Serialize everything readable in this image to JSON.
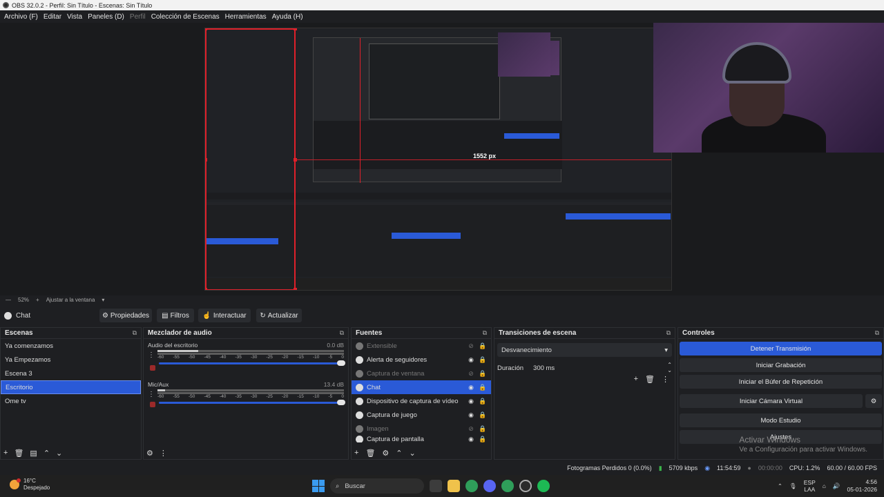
{
  "window": {
    "title": "OBS 32.0.2 - Perfil: Sin Título - Escenas: Sin Título"
  },
  "menu": [
    {
      "label": "Archivo (F)",
      "enabled": true
    },
    {
      "label": "Editar",
      "enabled": true
    },
    {
      "label": "Vista",
      "enabled": true
    },
    {
      "label": "Paneles (D)",
      "enabled": true
    },
    {
      "label": "Perfil",
      "enabled": false
    },
    {
      "label": "Colección de Escenas",
      "enabled": true
    },
    {
      "label": "Herramientas",
      "enabled": true
    },
    {
      "label": "Ayuda (H)",
      "enabled": true
    }
  ],
  "preview": {
    "measure_label": "1552 px"
  },
  "zoom": {
    "level": "52%",
    "fit_label": "Ajustar a la ventana"
  },
  "source_toolbar": {
    "current_source": "Chat",
    "properties_label": "Propiedades",
    "filters_label": "Filtros",
    "interact_label": "Interactuar",
    "refresh_label": "Actualizar"
  },
  "scenes": {
    "title": "Escenas",
    "items": [
      "Ya comenzamos",
      "Ya Empezamos",
      "Escena 3",
      "Escritorio",
      "Ome tv"
    ],
    "selected_index": 3
  },
  "mixer": {
    "title": "Mezclador de audio",
    "channels": [
      {
        "name": "Audio del escritorio",
        "db": "0.0 dB"
      },
      {
        "name": "Mic/Aux",
        "db": "13.4 dB"
      }
    ],
    "ticks": [
      "-60",
      "-55",
      "-50",
      "-45",
      "-40",
      "-35",
      "-30",
      "-25",
      "-20",
      "-15",
      "-10",
      "-5",
      "0"
    ]
  },
  "sources": {
    "title": "Fuentes",
    "items": [
      {
        "name": "Extensible",
        "visible": false,
        "icon": "browser-icon"
      },
      {
        "name": "Alerta de seguidores",
        "visible": true,
        "icon": "browser-icon"
      },
      {
        "name": "Captura de ventana",
        "visible": false,
        "icon": "window-icon"
      },
      {
        "name": "Chat",
        "visible": true,
        "icon": "browser-icon",
        "selected": true
      },
      {
        "name": "Dispositivo de captura de vídeo",
        "visible": true,
        "icon": "camera-icon"
      },
      {
        "name": "Captura de juego",
        "visible": true,
        "icon": "gamepad-icon"
      },
      {
        "name": "Imagen",
        "visible": false,
        "icon": "image-icon"
      },
      {
        "name": "Captura de pantalla",
        "visible": true,
        "icon": "monitor-icon"
      }
    ]
  },
  "transitions": {
    "title": "Transiciones de escena",
    "selected": "Desvanecimiento",
    "duration_label": "Duración",
    "duration_value": "300 ms"
  },
  "controls": {
    "title": "Controles",
    "buttons": [
      "Detener Transmisión",
      "Iniciar Grabación",
      "Iniciar el Búfer de Repetición",
      "Iniciar Cámara Virtual",
      "Modo Estudio",
      "Ajustes"
    ]
  },
  "watermark": {
    "line1": "Activar Windows",
    "line2": "Ve a Configuración para activar Windows."
  },
  "status": {
    "dropped": "Fotogramas Perdidos 0 (0.0%)",
    "bitrate": "5709 kbps",
    "live_time": "11:54:59",
    "rec_time": "00:00:00",
    "cpu": "CPU: 1.2%",
    "fps": "60.00 / 60.00 FPS"
  },
  "taskbar": {
    "temp": "16°C",
    "weather": "Despejado",
    "search_placeholder": "Buscar",
    "lang1": "ESP",
    "lang2": "LAA",
    "time": "4:56",
    "date": "05-01-2026"
  },
  "colors": {
    "accent": "#2a5ad7",
    "selection_red": "#e0202a",
    "panel_bg": "#1e1f22"
  }
}
